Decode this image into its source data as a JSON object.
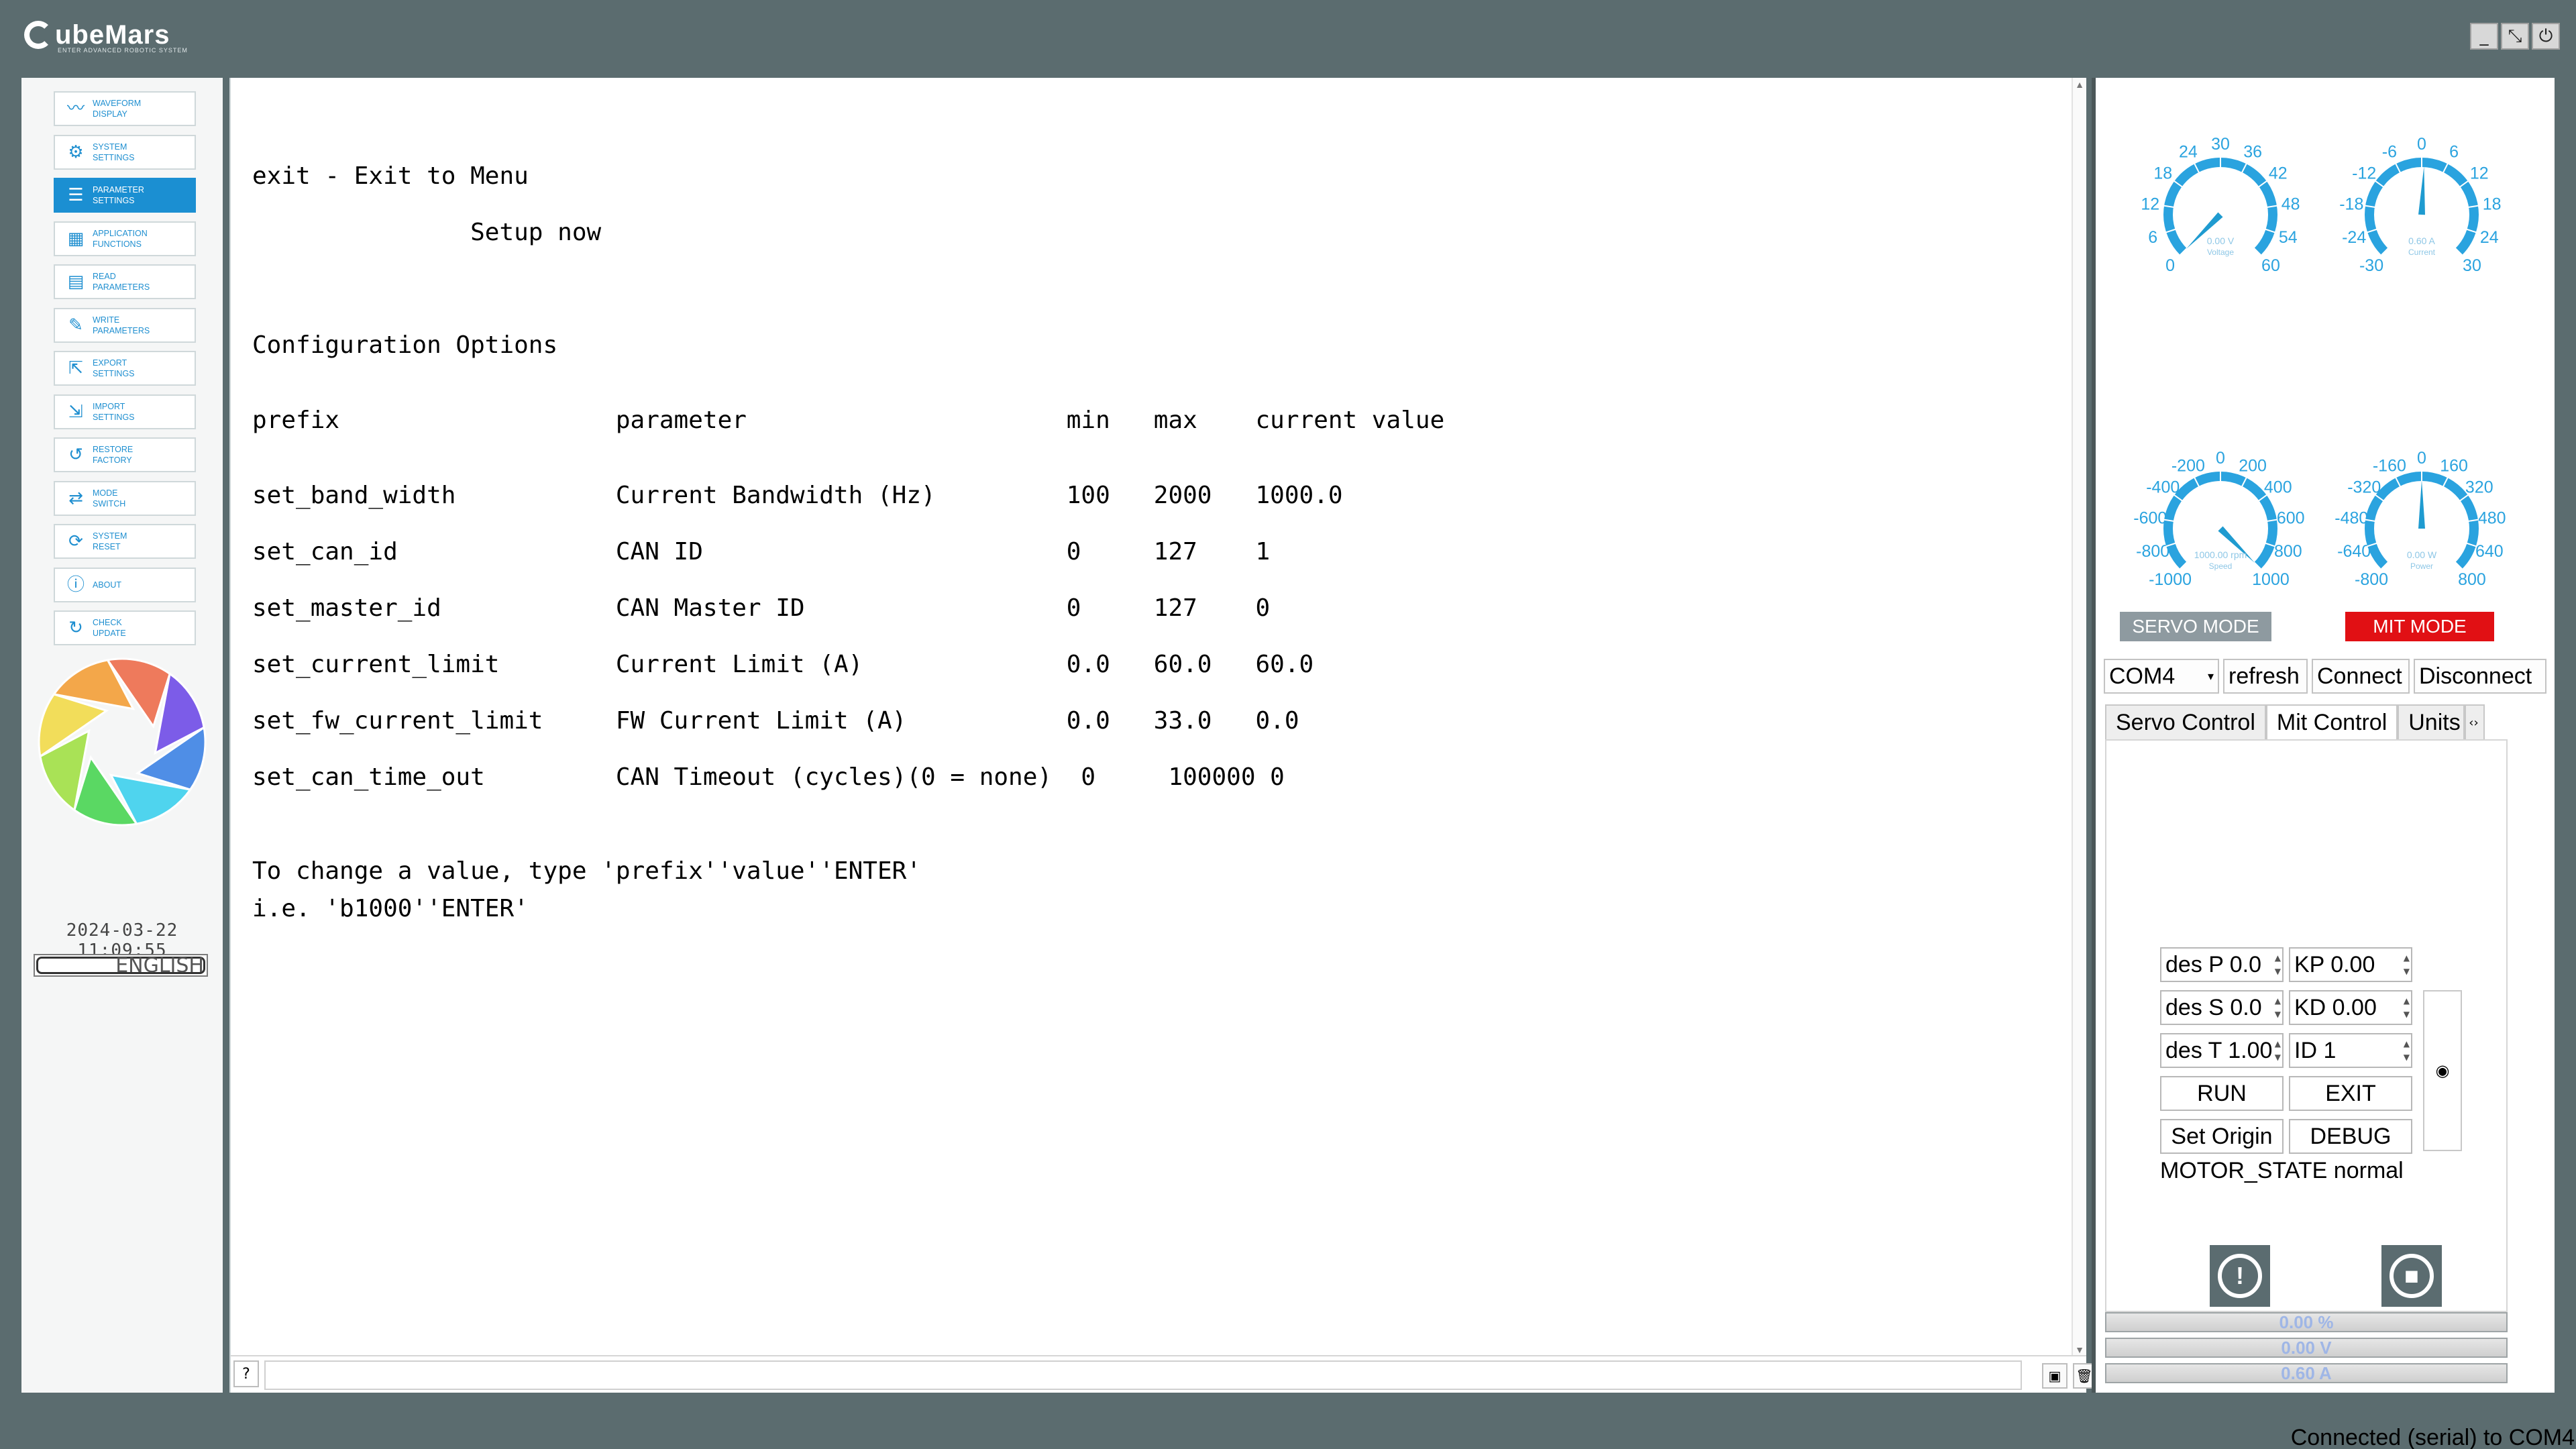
{
  "app": {
    "logo_text": "ubeMars",
    "logo_sub": "ENTER ADVANCED ROBOTIC SYSTEM",
    "window_buttons": [
      "_",
      "⤡",
      "⏻"
    ]
  },
  "sidebar": {
    "items": [
      {
        "label": "WAVEFORM\nDISPLAY",
        "icon": "waveform-icon",
        "glyph": "〰"
      },
      {
        "label": "SYSTEM\nSETTINGS",
        "icon": "gear-icon",
        "glyph": "⚙"
      },
      {
        "label": "PARAMETER\nSETTINGS",
        "icon": "sliders-icon",
        "glyph": "☰",
        "active": true
      },
      {
        "label": "APPLICATION\nFUNCTIONS",
        "icon": "grid-icon",
        "glyph": "▦"
      },
      {
        "label": "READ\nPARAMETERS",
        "icon": "read-icon",
        "glyph": "▤"
      },
      {
        "label": "WRITE\nPARAMETERS",
        "icon": "write-icon",
        "glyph": "✎"
      },
      {
        "label": "EXPORT\nSETTINGS",
        "icon": "export-icon",
        "glyph": "⇱"
      },
      {
        "label": "IMPORT\nSETTINGS",
        "icon": "import-icon",
        "glyph": "⇲"
      },
      {
        "label": "RESTORE\nFACTORY",
        "icon": "restore-icon",
        "glyph": "↺"
      },
      {
        "label": "MODE\nSWITCH",
        "icon": "switch-icon",
        "glyph": "⇄"
      },
      {
        "label": "SYSTEM\nRESET",
        "icon": "reset-icon",
        "glyph": "⟳"
      },
      {
        "label": "ABOUT",
        "icon": "info-icon",
        "glyph": "ⓘ"
      },
      {
        "label": "CHECK\nUPDATE",
        "icon": "update-icon",
        "glyph": "↻"
      }
    ],
    "datetime": "2024-03-22 11:09:55",
    "language": "ENGLISH"
  },
  "console": {
    "lines": [
      "exit - Exit to Menu",
      "               Setup now",
      "Configuration Options",
      "prefix                   parameter                      min   max    current value",
      "set_band_width           Current Bandwidth (Hz)         100   2000   1000.0",
      "set_can_id               CAN ID                         0     127    1",
      "set_master_id            CAN Master ID                  0     127    0",
      "set_current_limit        Current Limit (A)              0.0   60.0   60.0",
      "set_fw_current_limit     FW Current Limit (A)           0.0   33.0   0.0",
      "set_can_time_out         CAN Timeout (cycles)(0 = none)  0     100000 0",
      "To change a value, type 'prefix''value''ENTER'",
      "i.e. 'b1000''ENTER'"
    ],
    "input_value": ""
  },
  "gauges": [
    {
      "name": "voltage-gauge",
      "ticks": [
        "0",
        "6",
        "12",
        "18",
        "24",
        "30",
        "36",
        "42",
        "48",
        "54",
        "60"
      ],
      "readout": "0.00 V",
      "label": "Voltage",
      "value": 0.0
    },
    {
      "name": "current-gauge",
      "ticks": [
        "-30",
        "-24",
        "-18",
        "-12",
        "-6",
        "0",
        "6",
        "12",
        "18",
        "24",
        "30"
      ],
      "readout": "0.60 A",
      "label": "Current",
      "value": 0.6
    },
    {
      "name": "speed-gauge",
      "ticks": [
        "-1000",
        "-800",
        "-600",
        "-400",
        "-200",
        "0",
        "200",
        "400",
        "600",
        "800",
        "1000"
      ],
      "readout": "1000.00 rpm",
      "label": "Speed",
      "value": 1000.0
    },
    {
      "name": "power-gauge",
      "ticks": [
        "-800",
        "-640",
        "-480",
        "-320",
        "-160",
        "0",
        "160",
        "320",
        "480",
        "640",
        "800"
      ],
      "readout": "0.00 W",
      "label": "Power",
      "value": 0.0
    }
  ],
  "controls": {
    "servo_mode": "SERVO MODE",
    "mit_mode": "MIT MODE",
    "com_port": "COM4",
    "refresh": "refresh",
    "connect": "Connect",
    "disconnect": "Disconnect",
    "tabs": [
      "Servo Control",
      "Mit Control",
      "Units"
    ],
    "des_p": "des P 0.0",
    "des_s": "des S 0.0",
    "des_t": "des T 1.00",
    "kp": "KP 0.00",
    "kd": "KD 0.00",
    "id": "ID 1",
    "run": "RUN",
    "exit": "EXIT",
    "set_origin": "Set Origin",
    "debug": "DEBUG",
    "motor_state": "MOTOR_STATE normal",
    "meters": [
      "0.00 %",
      "0.00 V",
      "0.60 A"
    ]
  },
  "status": "Connected (serial) to COM4",
  "colors": {
    "accent": "#1b8fd2",
    "mit": "#e11014",
    "gauge": "#2aa3df"
  }
}
